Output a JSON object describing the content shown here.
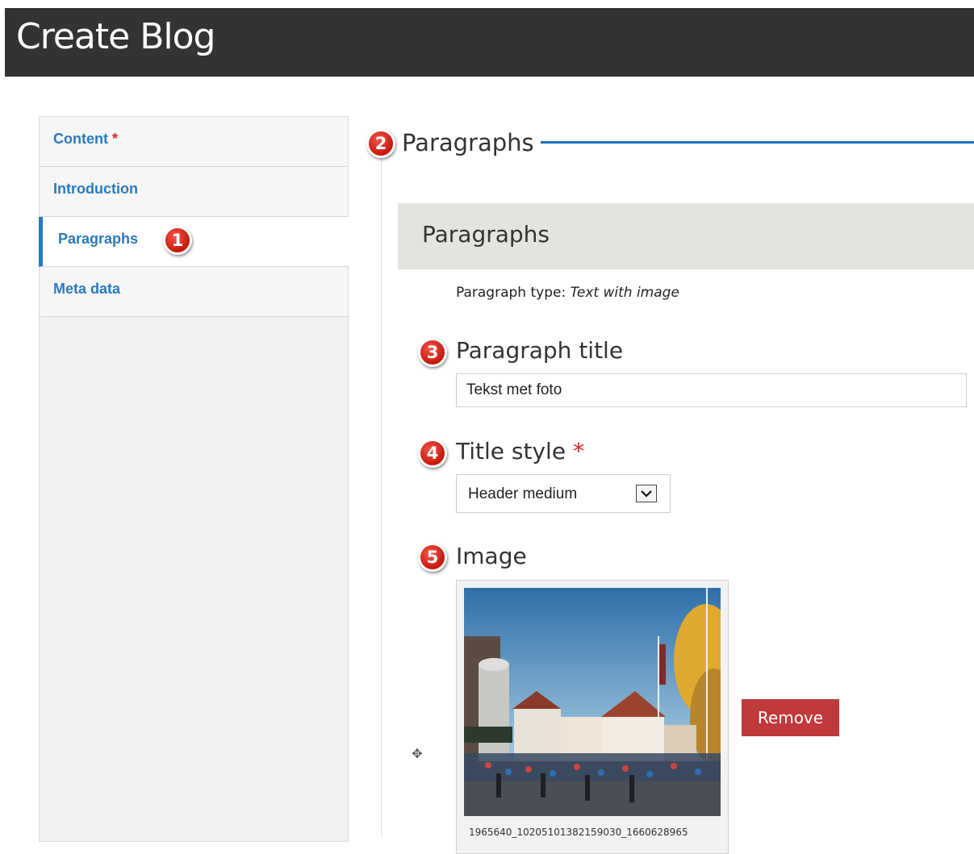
{
  "header": {
    "title": "Create Blog"
  },
  "tabs": [
    {
      "label": "Content",
      "required_mark": "*"
    },
    {
      "label": "Introduction"
    },
    {
      "label": "Paragraphs"
    },
    {
      "label": "Meta data"
    }
  ],
  "badges": [
    "1",
    "2",
    "3",
    "4",
    "5"
  ],
  "fieldset": {
    "legend": "Paragraphs"
  },
  "paragraph": {
    "box_title": "Paragraphs",
    "type_label": "Paragraph type:",
    "type_value": "Text with image"
  },
  "fields": {
    "title": {
      "label": "Paragraph title",
      "value": "Tekst met foto"
    },
    "style": {
      "label": "Title style",
      "required_mark": "*",
      "value": "Header medium"
    },
    "image": {
      "label": "Image",
      "filename": "1965640_10205101382159030_1660628965",
      "remove_label": "Remove",
      "drag_glyph": "✥"
    }
  },
  "colors": {
    "accent": "#1a73c0",
    "tab_link": "#2a7abf",
    "remove": "#c0393b",
    "badge": "#d6281b"
  }
}
